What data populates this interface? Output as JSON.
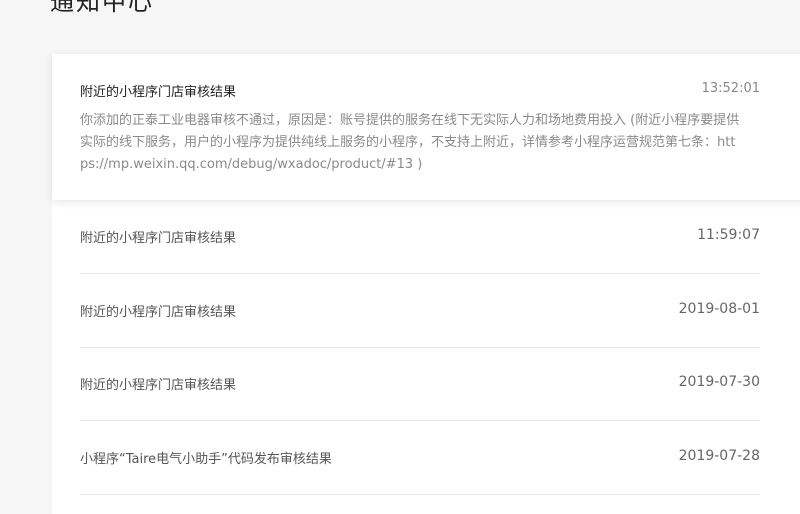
{
  "page": {
    "title": "通知中心"
  },
  "messages": [
    {
      "title": "附近的小程序门店审核结果",
      "time": "13:52:01",
      "content": "你添加的正泰工业电器审核不通过，原因是：账号提供的服务在线下无实际人力和场地费用投入 (附近小程序要提供实际的线下服务，用户的小程序为提供纯线上服务的小程序，不支持上附近，详情参考小程序运营规范第七条：https://mp.weixin.qq.com/debug/wxadoc/product/#13 )",
      "expanded": true
    },
    {
      "title": "附近的小程序门店审核结果",
      "time": "11:59:07"
    },
    {
      "title": "附近的小程序门店审核结果",
      "time": "2019-08-01"
    },
    {
      "title": "附近的小程序门店审核结果",
      "time": "2019-07-30"
    },
    {
      "title": "小程序“Taire电气小助手”代码发布审核结果",
      "time": "2019-07-28"
    }
  ]
}
